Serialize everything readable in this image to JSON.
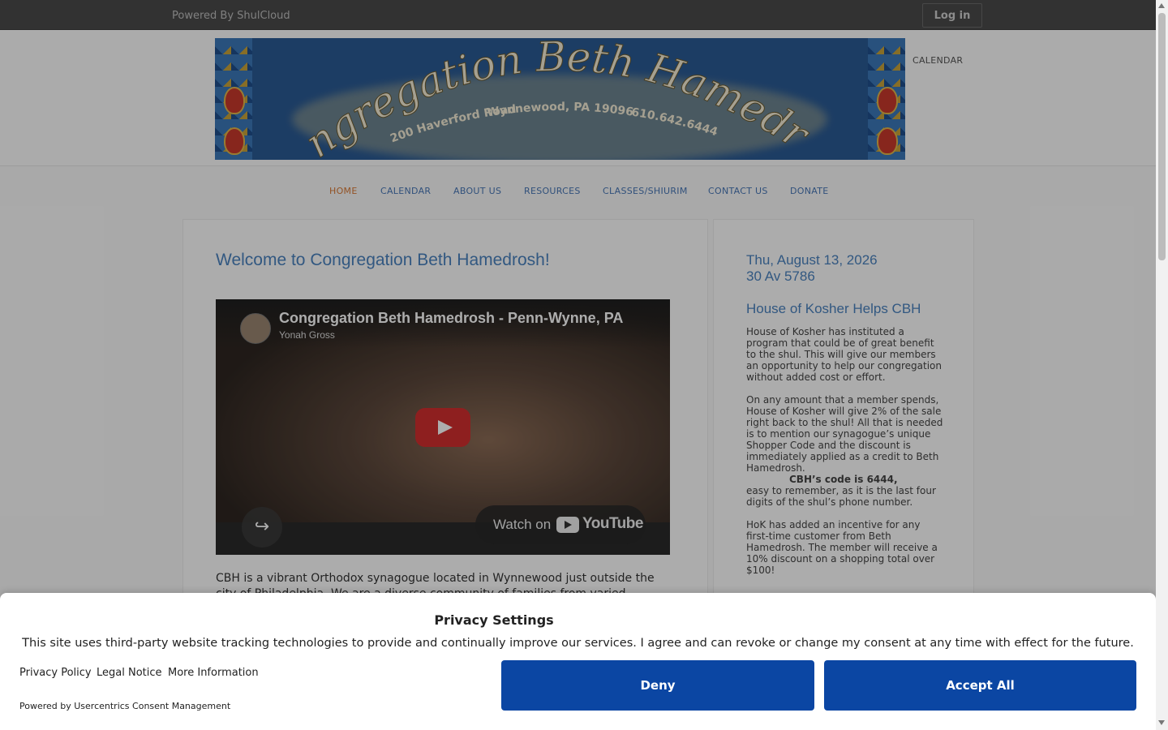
{
  "topbar": {
    "powered_by": "Powered By ShulCloud",
    "login_label": "Log in"
  },
  "header": {
    "banner": {
      "title": "Congregation Beth Hamedrosh",
      "address": "200 Haverford Road",
      "city": "Wynnewood, PA  19096",
      "phone": "610.642.6444"
    },
    "calendar_link": "CALENDAR"
  },
  "nav": {
    "items": [
      {
        "label": "HOME",
        "active": true
      },
      {
        "label": "CALENDAR"
      },
      {
        "label": "ABOUT US"
      },
      {
        "label": "RESOURCES"
      },
      {
        "label": "CLASSES/SHIURIM"
      },
      {
        "label": "CONTACT US"
      },
      {
        "label": "DONATE"
      }
    ]
  },
  "main": {
    "title": "Welcome to Congregation Beth Hamedrosh!",
    "video": {
      "title": "Congregation Beth Hamedrosh - Penn-Wynne, PA",
      "channel": "Yonah Gross",
      "watch_on": "Watch on",
      "youtube": "YouTube"
    },
    "intro": "CBH is a vibrant Orthodox synagogue located in Wynnewood just outside the city of Philadelphia. We are a diverse community of families from varied"
  },
  "sidebar": {
    "date_line1": "Thu, August 13, 2026",
    "date_line2": "30 Av 5786",
    "heading": "House of Kosher Helps CBH",
    "para1": "House of Kosher has instituted a program that could be of great benefit to the shul. This will give our members an opportunity to help our congregation without added cost or effort.",
    "para2": "On any amount that a member spends, House of Kosher will give 2% of the sale right back to the shul! All that is needed is to mention our synagogue’s unique Shopper Code and the discount is immediately applied as a credit to Beth Hamedrosh.",
    "code": "CBH’s code is 6444,",
    "para3": "easy to remember, as it is the last four digits of the shul’s phone number.",
    "para4": "HoK has added an incentive for any first-time customer from Beth Hamedrosh. The member will receive a 10% discount on a shopping total over $100!"
  },
  "consent": {
    "title": "Privacy Settings",
    "text": "This site uses third-party website tracking technologies to provide and continually improve our services. I agree and can revoke or change my consent at any time with effect for the future.",
    "links": [
      "Privacy Policy",
      "Legal Notice",
      "More Information"
    ],
    "powered_by": "Powered by Usercentrics Consent Management",
    "deny_label": "Deny",
    "accept_label": "Accept All",
    "button_color": "#0b46a3"
  },
  "colors": {
    "link": "#4a82bf",
    "active_nav": "#d97a35",
    "topbar": "#4a4a4a"
  }
}
